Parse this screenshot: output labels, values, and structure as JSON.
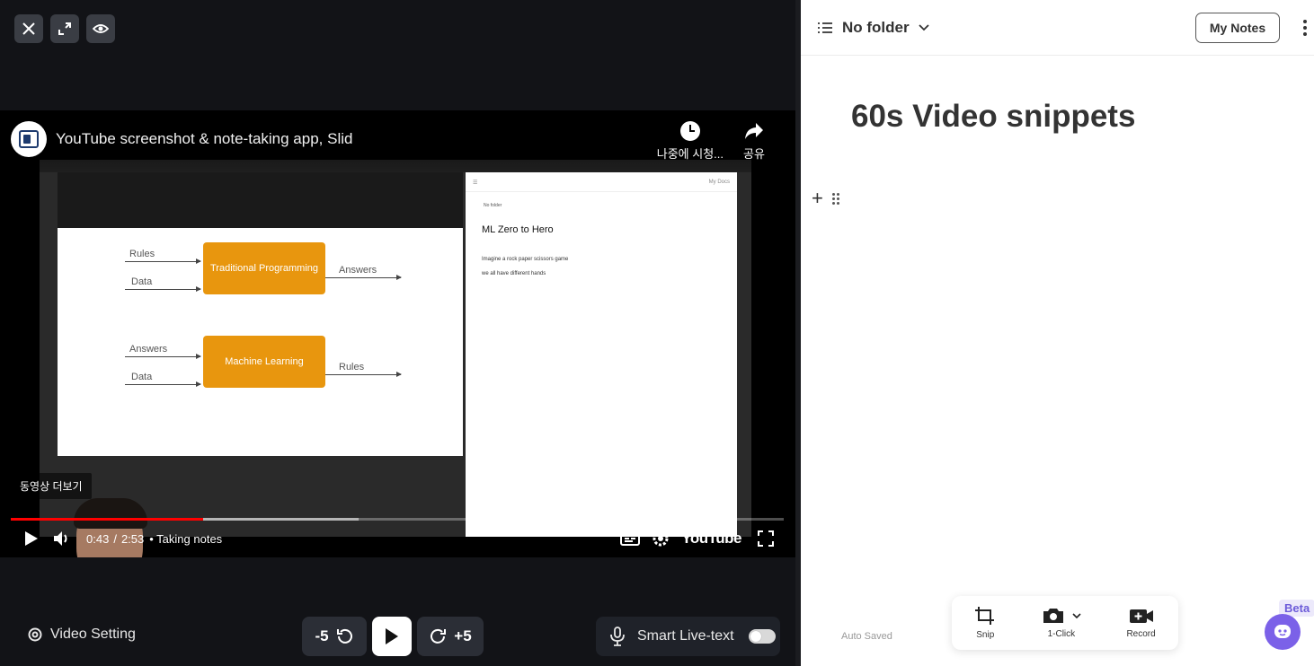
{
  "player": {
    "video_title": "YouTube screenshot & note-taking app, Slid",
    "watch_later": "나중에 시청...",
    "share": "공유",
    "more_videos": "동영상 더보기",
    "current_time": "0:43",
    "separator": "/",
    "duration": "2:53",
    "chapter": "• Taking notes",
    "logo": "YouTube",
    "progress_fraction": 0.249,
    "buffered_fraction": 0.45
  },
  "inner_slide": {
    "traditional": "Traditional Programming",
    "ml": "Machine Learning",
    "rules": "Rules",
    "data": "Data",
    "answers": "Answers"
  },
  "inner_doc": {
    "folder": "No folder",
    "my_docs": "My Docs",
    "title": "ML Zero to Hero",
    "line1": "Imagine a rock paper scissors game",
    "line2": "we all have different hands"
  },
  "bottombar": {
    "video_setting": "Video Setting",
    "back": "-5",
    "forward": "+5",
    "live_text": "Smart Live-text"
  },
  "notes": {
    "folder": "No folder",
    "my_notes": "My Notes",
    "doc_title": "60s Video snippets",
    "auto_saved": "Auto Saved",
    "tools": [
      "Snip",
      "1-Click",
      "Record"
    ],
    "beta": "Beta"
  },
  "colors": {
    "accent": "#7b61e8",
    "progress": "#ff0000",
    "slide_box": "#e8960e"
  }
}
